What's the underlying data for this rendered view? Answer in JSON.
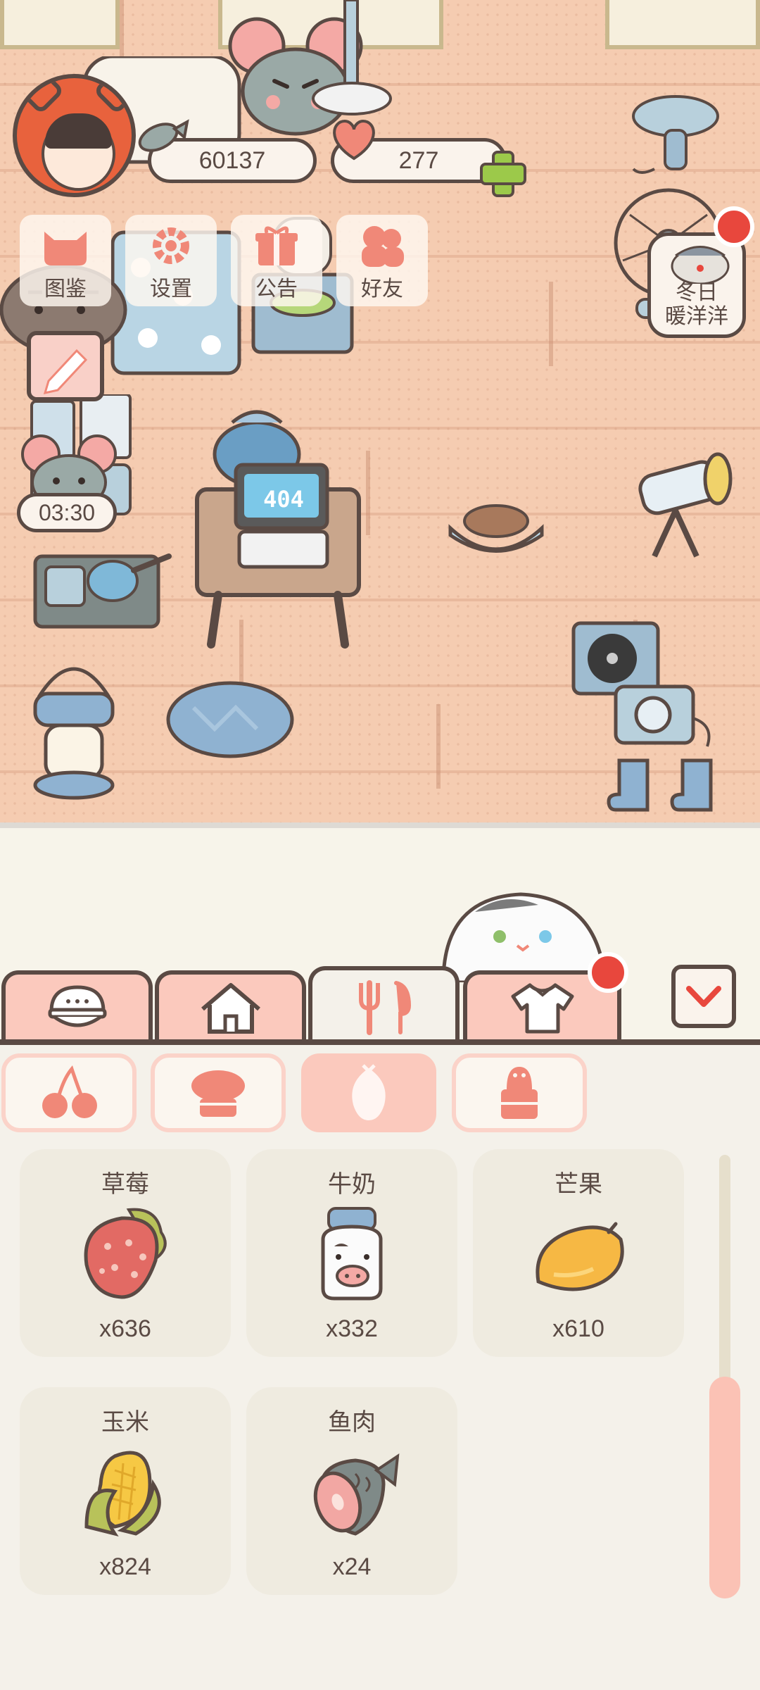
{
  "hud": {
    "fish_count": "60137",
    "heart_count": "277"
  },
  "menu": {
    "items": [
      {
        "label": "图鉴",
        "icon": "cat-head-icon"
      },
      {
        "label": "设置",
        "icon": "gear-icon"
      },
      {
        "label": "公告",
        "icon": "gift-icon"
      },
      {
        "label": "好友",
        "icon": "friends-icon"
      }
    ]
  },
  "scene": {
    "timer": "03:30",
    "event_label_line1": "冬日",
    "event_label_line2": "暖洋洋",
    "computer_screen": "404"
  },
  "tabs": [
    {
      "icon": "food-bowl-icon",
      "active": false
    },
    {
      "icon": "house-icon",
      "active": false
    },
    {
      "icon": "utensils-icon",
      "active": true
    },
    {
      "icon": "shirt-icon",
      "active": false
    }
  ],
  "filters": [
    {
      "icon": "cherry-icon",
      "active": false
    },
    {
      "icon": "cake-icon",
      "active": false
    },
    {
      "icon": "seed-icon",
      "active": true
    },
    {
      "icon": "jar-icon",
      "active": false
    }
  ],
  "items": [
    {
      "name": "草莓",
      "qty": "x636",
      "icon": "strawberry-icon"
    },
    {
      "name": "牛奶",
      "qty": "x332",
      "icon": "milk-icon"
    },
    {
      "name": "芒果",
      "qty": "x610",
      "icon": "mango-icon"
    },
    {
      "name": "玉米",
      "qty": "x824",
      "icon": "corn-icon"
    },
    {
      "name": "鱼肉",
      "qty": "x24",
      "icon": "fish-meat-icon"
    }
  ],
  "colors": {
    "accent_pink": "#fbc9bd",
    "outline": "#5a4a44",
    "alert_red": "#e8473d",
    "floor": "#f5ccb1"
  }
}
